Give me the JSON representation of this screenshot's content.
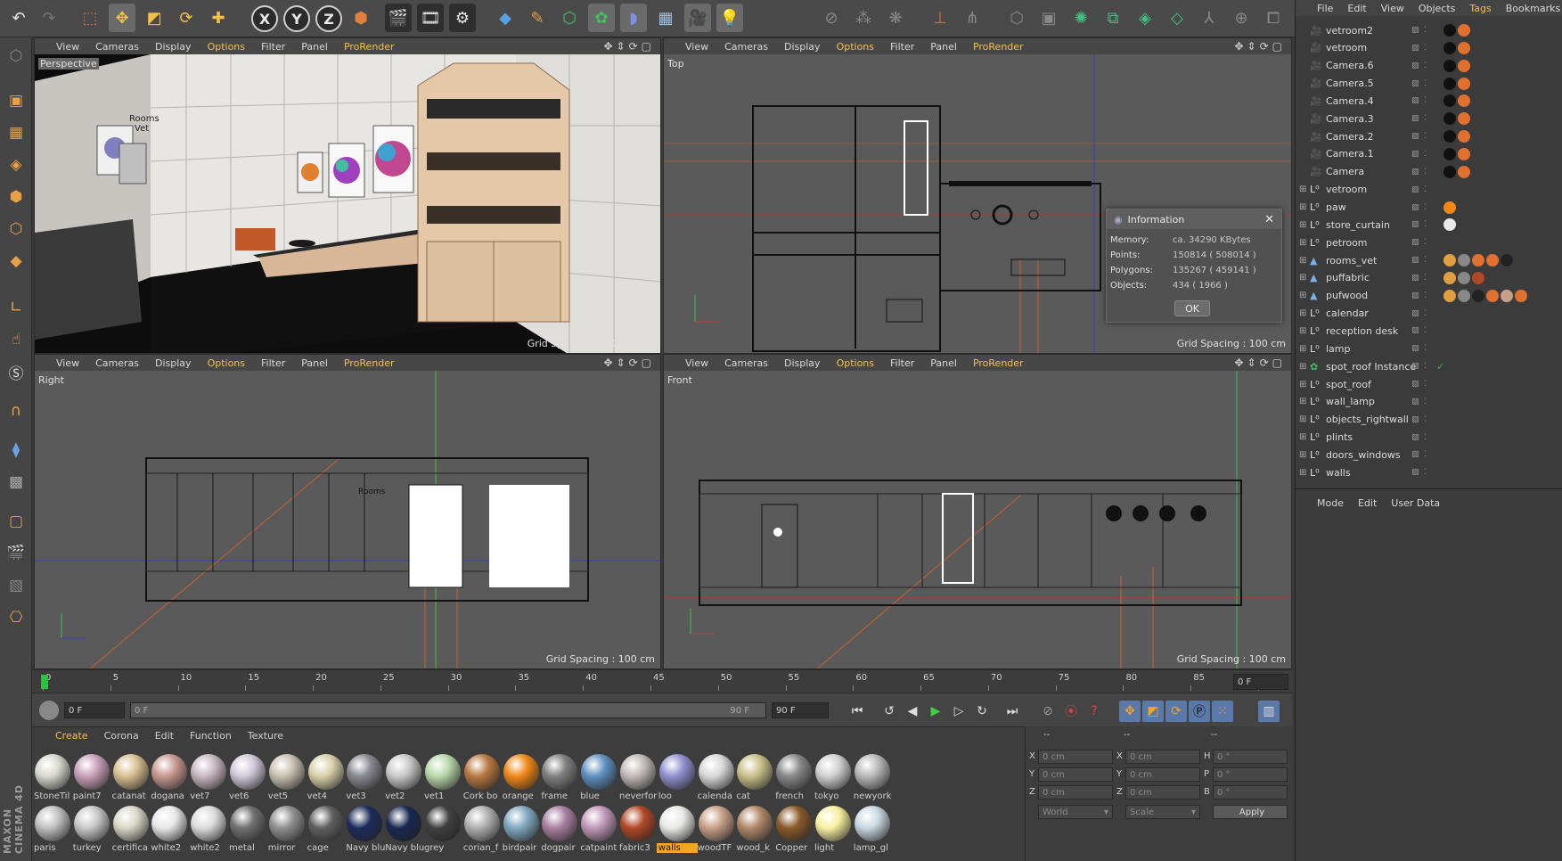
{
  "topbar": {
    "axis_x": "X",
    "axis_y": "Y",
    "axis_z": "Z"
  },
  "viewport_menu": [
    "View",
    "Cameras",
    "Display",
    "Options",
    "Filter",
    "Panel",
    "ProRender"
  ],
  "viewports": {
    "perspective": {
      "name": "Perspective",
      "grid": "Grid Spacing : 100000 cm"
    },
    "top": {
      "name": "Top",
      "grid": "Grid Spacing : 100 cm"
    },
    "right": {
      "name": "Right",
      "grid": "Grid Spacing : 100 cm"
    },
    "front": {
      "name": "Front",
      "grid": "Grid Spacing : 100 cm"
    }
  },
  "scene_text": {
    "sign": "Rooms\nVet"
  },
  "info_dialog": {
    "title": "Information",
    "rows": [
      {
        "k": "Memory:",
        "v": "ca. 34290 KBytes"
      },
      {
        "k": "Points:",
        "v": "150814 ( 508014 )"
      },
      {
        "k": "Polygons:",
        "v": "135267 ( 459141 )"
      },
      {
        "k": "Objects:",
        "v": "434 ( 1966 )"
      }
    ],
    "ok": "OK"
  },
  "timeline": {
    "ticks": [
      "0",
      "5",
      "10",
      "15",
      "20",
      "25",
      "30",
      "35",
      "40",
      "45",
      "50",
      "55",
      "60",
      "65",
      "70",
      "75",
      "80",
      "85",
      "90"
    ],
    "current_frame": "0 F"
  },
  "transport": {
    "start": "0 F",
    "range_start": "0 F",
    "range_end": "90 F",
    "end": "90 F"
  },
  "materials_menu": [
    "Create",
    "Corona",
    "Edit",
    "Function",
    "Texture"
  ],
  "materials_row1": [
    {
      "name": "StoneTil",
      "color": "#d8d8d0"
    },
    {
      "name": "paint7",
      "color": "#c8a0b8"
    },
    {
      "name": "catanat",
      "color": "#d8c090"
    },
    {
      "name": "dogana",
      "color": "#c89890"
    },
    {
      "name": "vet7",
      "color": "#c8b8c0"
    },
    {
      "name": "vet6",
      "color": "#d0c8d8"
    },
    {
      "name": "vet5",
      "color": "#c8c0b0"
    },
    {
      "name": "vet4",
      "color": "#d8d0a8"
    },
    {
      "name": "vet3",
      "color": "#888890"
    },
    {
      "name": "vet2",
      "color": "#c8c8c8"
    },
    {
      "name": "vet1",
      "color": "#b8d8a8"
    },
    {
      "name": "Cork bo",
      "color": "#b87840"
    },
    {
      "name": "orange",
      "color": "#f08818"
    },
    {
      "name": "frame",
      "color": "#808080"
    },
    {
      "name": "blue",
      "color": "#6090c0"
    },
    {
      "name": "neverfor",
      "color": "#c0b8b8"
    },
    {
      "name": "loo",
      "color": "#9090d0"
    },
    {
      "name": "calenda",
      "color": "#d8d8d8"
    },
    {
      "name": "cat",
      "color": "#c8c088"
    },
    {
      "name": "french",
      "color": "#888888"
    },
    {
      "name": "tokyo",
      "color": "#d0d0d0"
    },
    {
      "name": "newyork",
      "color": "#b8b8b8"
    }
  ],
  "materials_row2": [
    {
      "name": "paris",
      "color": "#c0c0c0"
    },
    {
      "name": "turkey",
      "color": "#c8c8c8"
    },
    {
      "name": "certifica",
      "color": "#d8d8c8"
    },
    {
      "name": "white2",
      "color": "#e8e8e8"
    },
    {
      "name": "white2",
      "color": "#dcdcdc"
    },
    {
      "name": "metal",
      "color": "#707070"
    },
    {
      "name": "mirror",
      "color": "#909090"
    },
    {
      "name": "cage",
      "color": "#606060"
    },
    {
      "name": "Navy blu",
      "color": "#1c2c5c"
    },
    {
      "name": "Navy blu",
      "color": "#182850"
    },
    {
      "name": "grey",
      "color": "#404040"
    },
    {
      "name": "corian_f",
      "color": "#b0b0b0"
    },
    {
      "name": "birdpair",
      "color": "#80a8c0"
    },
    {
      "name": "dogpair",
      "color": "#a880a0"
    },
    {
      "name": "catpaint",
      "color": "#c098b8"
    },
    {
      "name": "fabric3",
      "color": "#b04828"
    },
    {
      "name": "walls",
      "color": "#e8e8e4"
    },
    {
      "name": "woodTF",
      "color": "#c8a088"
    },
    {
      "name": "wood_k",
      "color": "#b08868"
    },
    {
      "name": "Copper",
      "color": "#8a5a2a"
    },
    {
      "name": "light",
      "color": "#f8f0a0"
    },
    {
      "name": "lamp_gl",
      "color": "#c8d8e0"
    }
  ],
  "selected_material": "walls",
  "coords": {
    "headers": [
      "--",
      "--",
      "--"
    ],
    "rows": [
      {
        "a": "X",
        "av": "0 cm",
        "b": "X",
        "bv": "0 cm",
        "c": "H",
        "cv": "0 °"
      },
      {
        "a": "Y",
        "av": "0 cm",
        "b": "Y",
        "bv": "0 cm",
        "c": "P",
        "cv": "0 °"
      },
      {
        "a": "Z",
        "av": "0 cm",
        "b": "Z",
        "bv": "0 cm",
        "c": "B",
        "cv": "0 °"
      }
    ],
    "mode1": "World",
    "mode2": "Scale",
    "apply": "Apply"
  },
  "object_menu": [
    "File",
    "Edit",
    "View",
    "Objects",
    "Tags",
    "Bookmarks"
  ],
  "objects": [
    {
      "name": "vetroom2",
      "type": "camera"
    },
    {
      "name": "vetroom",
      "type": "camera"
    },
    {
      "name": "Camera.6",
      "type": "camera"
    },
    {
      "name": "Camera.5",
      "type": "camera"
    },
    {
      "name": "Camera.4",
      "type": "camera"
    },
    {
      "name": "Camera.3",
      "type": "camera"
    },
    {
      "name": "Camera.2",
      "type": "camera"
    },
    {
      "name": "Camera.1",
      "type": "camera"
    },
    {
      "name": "Camera",
      "type": "camera"
    },
    {
      "name": "vetroom",
      "type": "null"
    },
    {
      "name": "paw",
      "type": "null"
    },
    {
      "name": "store_curtain",
      "type": "null"
    },
    {
      "name": "petroom",
      "type": "null"
    },
    {
      "name": "rooms_vet",
      "type": "mesh"
    },
    {
      "name": "puffabric",
      "type": "mesh"
    },
    {
      "name": "pufwood",
      "type": "mesh"
    },
    {
      "name": "calendar",
      "type": "null"
    },
    {
      "name": "reception desk",
      "type": "null"
    },
    {
      "name": "lamp",
      "type": "null"
    },
    {
      "name": "spot_roof Instance",
      "type": "instance"
    },
    {
      "name": "spot_roof",
      "type": "null"
    },
    {
      "name": "wall_lamp",
      "type": "null"
    },
    {
      "name": "objects_rightwall",
      "type": "null"
    },
    {
      "name": "plints",
      "type": "null"
    },
    {
      "name": "doors_windows",
      "type": "null"
    },
    {
      "name": "walls",
      "type": "null"
    }
  ],
  "attr_menu": [
    "Mode",
    "Edit",
    "User Data"
  ],
  "branding": "MAXON CINEMA 4D",
  "colors": {
    "accent": "#f4c04a",
    "selection": "#f4a522"
  }
}
